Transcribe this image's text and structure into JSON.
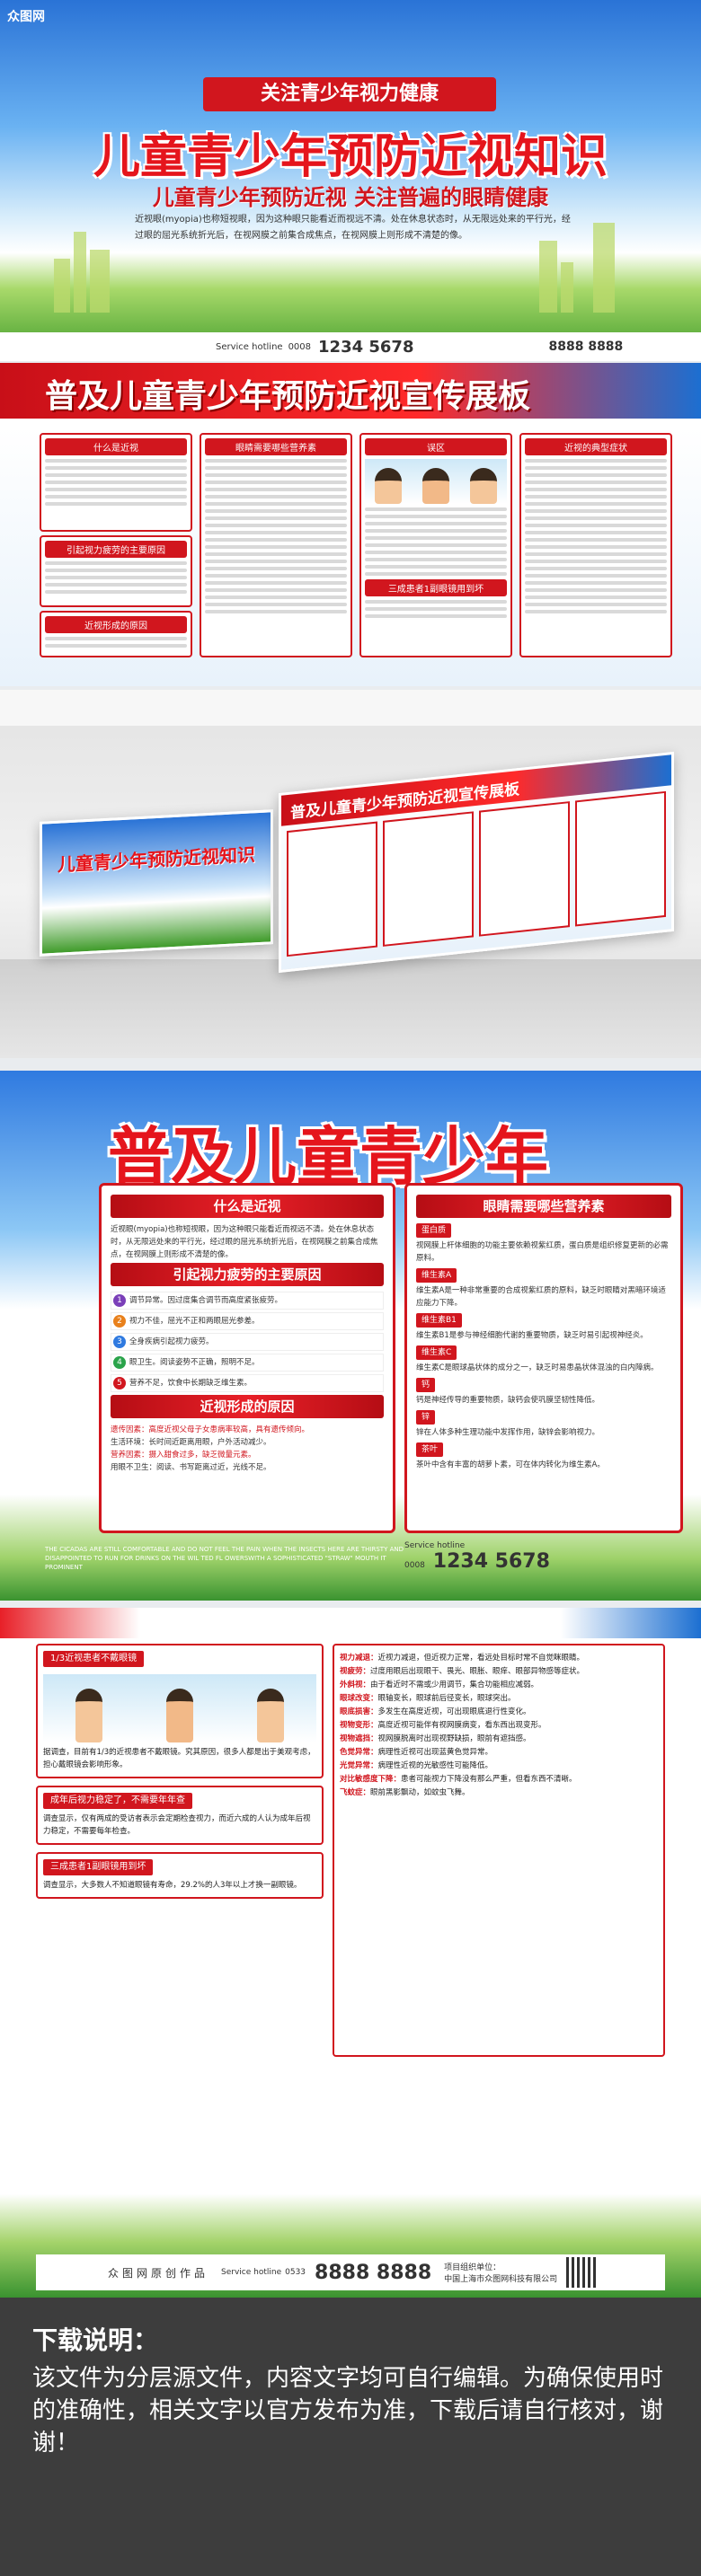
{
  "banner1": {
    "logo": "众图网",
    "tag": "关注青少年视力健康",
    "title": "儿童青少年预防近视知识",
    "subtitle": "儿童青少年预防近视  关注普遍的眼睛健康",
    "intro": "近视眼(myopia)也称短视眼，因为这种眼只能看近而视远不清。处在休息状态时，从无限远处来的平行光，经过眼的屈光系统折光后，在视网膜之前集合成焦点，在视网膜上则形成不清楚的像。",
    "footer_service": "Service hotline",
    "footer_code": "0008",
    "footer_phone": "1234 5678",
    "footer_right": "8888 8888"
  },
  "banner2": {
    "title": "普及儿童青少年预防近视宣传展板",
    "panels": [
      "什么是近视",
      "眼睛需要哪些营养素",
      "误区",
      "近视的典型症状"
    ],
    "panels2": [
      "引起视力疲劳的主要原因",
      "近视形成的原因",
      "三成患者1副眼镜用到坏"
    ]
  },
  "detail1": {
    "big_title": "普及儿童青少年",
    "left": {
      "h1": "什么是近视",
      "p1": "近视眼(myopia)也称短视眼，因为这种眼只能看近而视远不清。处在休息状态时，从无限远处来的平行光，经过眼的屈光系统折光后，在视网膜之前集合成焦点，在视网膜上则形成不清楚的像。",
      "h2": "引起视力疲劳的主要原因",
      "causes": [
        "调节异常。因过度集合调节而高度紧张疲劳。",
        "视力不佳，屈光不正和两眼屈光参差。",
        "全身疾病引起视力疲劳。",
        "眼卫生。阅读姿势不正确，照明不足。",
        "营养不足，饮食中长期缺乏维生素。"
      ],
      "h3": "近视形成的原因",
      "reasons": [
        "遗传因素：高度近视父母子女患病率较高，具有遗传倾向。",
        "生活环境：长时间近距离用眼，户外活动减少。",
        "营养因素：摄入甜食过多，缺乏微量元素。",
        "用眼不卫生：阅读、书写距离过近，光线不足。"
      ]
    },
    "right": {
      "h1": "眼睛需要哪些营养素",
      "items": [
        {
          "name": "蛋白质",
          "text": "视网膜上杆体细胞的功能主要依赖视紫红质，蛋白质是组织修复更新的必需原料。"
        },
        {
          "name": "维生素A",
          "text": "维生素A是一种非常重要的合成视紫红质的原料，缺乏时眼睛对黑暗环境适应能力下降。"
        },
        {
          "name": "维生素B1",
          "text": "维生素B1是参与神经细胞代谢的重要物质，缺乏时易引起视神经炎。"
        },
        {
          "name": "维生素C",
          "text": "维生素C是眼球晶状体的成分之一，缺乏时易患晶状体混浊的白内障病。"
        },
        {
          "name": "钙",
          "text": "钙是神经传导的重要物质，缺钙会使巩膜坚韧性降低。"
        },
        {
          "name": "锌",
          "text": "锌在人体多种生理功能中发挥作用，缺锌会影响视力。"
        },
        {
          "name": "茶叶",
          "text": "茶叶中含有丰富的胡萝卜素，可在体内转化为维生素A。"
        }
      ]
    },
    "english": "THE CICADAS ARE STILL COMFORTABLE AND DO NOT FEEL THE PAIN WHEN THE INSECTS HERE ARE THIRSTY AND DISAPPOINTED TO RUN FOR DRINKS ON THE WIL TED FL OWERSWITH A SOPHISTICATED \"STRAW\" MOUTH IT PROMINENT",
    "footer_service": "Service hotline",
    "footer_code": "0008",
    "footer_phone": "1234 5678"
  },
  "detail2": {
    "left": {
      "h1": "1/3近视患者不戴眼镜",
      "p1": "据调查，目前有1/3的近视患者不戴眼镜。究其原因，很多人都是出于美观考虑，担心戴眼镜会影响形象。",
      "h2": "成年后视力稳定了，不需要年年查",
      "p2": "调查显示，仅有两成的受访者表示会定期检查视力，而近六成的人认为成年后视力稳定，不需要每年检查。",
      "h3": "三成患者1副眼镜用到坏",
      "p3": "调查显示，大多数人不知道眼镜有寿命，29.2%的人3年以上才换一副眼镜。"
    },
    "right": {
      "items": [
        {
          "k": "视力减退：",
          "v": "近视力减退，但近视力正常，看远处目标时常不自觉眯眼睛。"
        },
        {
          "k": "视疲劳：",
          "v": "过度用眼后出现眼干、畏光、眼胀、眼痒、眼部异物感等症状。"
        },
        {
          "k": "外斜视：",
          "v": "由于看近时不需或少用调节，集合功能相应减弱。"
        },
        {
          "k": "眼球改变：",
          "v": "眼轴变长，眼球前后径变长，眼球突出。"
        },
        {
          "k": "眼底损害：",
          "v": "多发生在高度近视，可出现眼底退行性变化。"
        },
        {
          "k": "视物变形：",
          "v": "高度近视可能伴有视网膜病变，看东西出现变形。"
        },
        {
          "k": "视物遮挡：",
          "v": "视网膜脱离时出现视野缺损，眼前有遮挡感。"
        },
        {
          "k": "色觉异常：",
          "v": "病理性近视可出现蓝黄色觉异常。"
        },
        {
          "k": "光觉异常：",
          "v": "病理性近视的光敏感性可能降低。"
        },
        {
          "k": "对比敏感度下降：",
          "v": "患者可能视力下降没有那么严重，但看东西不清晰。"
        },
        {
          "k": "飞蚊症：",
          "v": "眼前黑影飘动，如蚊虫飞舞。"
        }
      ]
    },
    "footer_site": "众图网原创作品",
    "footer_service": "Service hotline",
    "footer_code": "0533",
    "footer_phone": "8888 8888",
    "footer_unit": "项目组织单位：",
    "footer_unit2": "中国上海市众图网科技有限公司"
  },
  "download": {
    "title": "下载说明：",
    "desc": "该文件为分层源文件，内容文字均可自行编辑。为确保使用时的准确性，相关文字以官方发布为准，下载后请自行核对，谢谢！"
  },
  "colors": {
    "brand_red": "#d1161e",
    "sky_blue": "#2a73d6",
    "grass_green": "#3f9b2a"
  }
}
